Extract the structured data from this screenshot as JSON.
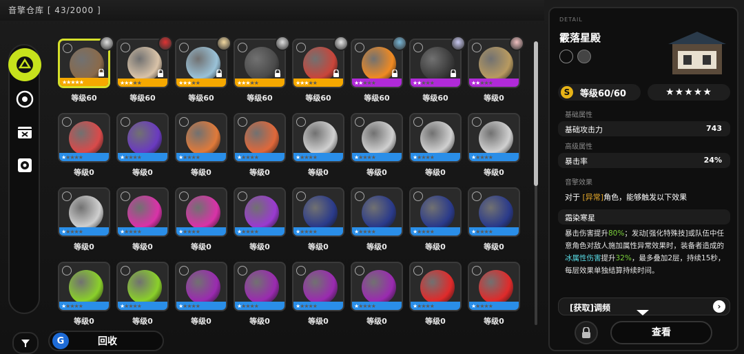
{
  "header": {
    "title": "音擎仓库 [ 43/2000 ]"
  },
  "sidebar": {
    "icons": [
      "category-all-icon",
      "disc-icon",
      "box-icon",
      "safe-icon"
    ],
    "filter_icon": "filter-icon"
  },
  "footer": {
    "recycle_label": "回收"
  },
  "grid": {
    "items": [
      {
        "level": "等级60",
        "stars": 5,
        "rarity": "gold",
        "art": "#8a6a4a",
        "avatar": "#e0e0e0",
        "locked": true,
        "selected": true
      },
      {
        "level": "等级60",
        "stars": 3,
        "rarity": "gold",
        "art": "#d9c3a8",
        "avatar": "#d33",
        "locked": true
      },
      {
        "level": "等级60",
        "stars": 3,
        "rarity": "gold",
        "art": "#9ac2d8",
        "avatar": "#f2d8a0",
        "locked": true
      },
      {
        "level": "等级60",
        "stars": 3,
        "rarity": "gold",
        "art": "#4a4a4a",
        "avatar": "#ddd",
        "locked": true
      },
      {
        "level": "等级60",
        "stars": 3,
        "rarity": "gold",
        "art": "#c9453a",
        "avatar": "#e6e6e6",
        "locked": true
      },
      {
        "level": "等级60",
        "stars": 2,
        "rarity": "purple",
        "art": "#f08a22",
        "avatar": "#7ab8d8",
        "locked": true
      },
      {
        "level": "等级60",
        "stars": 2,
        "rarity": "purple",
        "art": "#3a3a3a",
        "avatar": "#c8c8f0",
        "locked": true
      },
      {
        "level": "等级0",
        "stars": 2,
        "rarity": "purple",
        "art": "#b89a60",
        "avatar": "#f0c0c0",
        "locked": false
      },
      {
        "level": "等级0",
        "stars": 1,
        "rarity": "blue",
        "art": "#d94a4a",
        "locked": false
      },
      {
        "level": "等级0",
        "stars": 1,
        "rarity": "blue",
        "art": "#6a3ac0",
        "locked": false
      },
      {
        "level": "等级0",
        "stars": 1,
        "rarity": "blue",
        "art": "#e07a3a",
        "locked": false
      },
      {
        "level": "等级0",
        "stars": 1,
        "rarity": "blue",
        "art": "#e0683a",
        "locked": false
      },
      {
        "level": "等级0",
        "stars": 1,
        "rarity": "blue",
        "art": "#d0d0d0",
        "locked": false
      },
      {
        "level": "等级0",
        "stars": 1,
        "rarity": "blue",
        "art": "#d0d0d0",
        "locked": false
      },
      {
        "level": "等级0",
        "stars": 1,
        "rarity": "blue",
        "art": "#d0d0d0",
        "locked": false
      },
      {
        "level": "等级0",
        "stars": 1,
        "rarity": "blue",
        "art": "#d0d0d0",
        "locked": false
      },
      {
        "level": "等级0",
        "stars": 1,
        "rarity": "blue",
        "art": "#cfcfcf",
        "locked": false
      },
      {
        "level": "等级0",
        "stars": 1,
        "rarity": "blue",
        "art": "#d932a8",
        "locked": false
      },
      {
        "level": "等级0",
        "stars": 1,
        "rarity": "blue",
        "art": "#d932a8",
        "locked": false
      },
      {
        "level": "等级0",
        "stars": 1,
        "rarity": "blue",
        "art": "#9a3ad0",
        "locked": false
      },
      {
        "level": "等级0",
        "stars": 1,
        "rarity": "blue",
        "art": "#2a3a8a",
        "locked": false
      },
      {
        "level": "等级0",
        "stars": 1,
        "rarity": "blue",
        "art": "#2a3a8a",
        "locked": false
      },
      {
        "level": "等级0",
        "stars": 1,
        "rarity": "blue",
        "art": "#2a3a8a",
        "locked": false
      },
      {
        "level": "等级0",
        "stars": 1,
        "rarity": "blue",
        "art": "#2a3a8a",
        "locked": false
      },
      {
        "level": "等级0",
        "stars": 1,
        "rarity": "blue",
        "art": "#8ad02a",
        "locked": false
      },
      {
        "level": "等级0",
        "stars": 1,
        "rarity": "blue",
        "art": "#8ad02a",
        "locked": false
      },
      {
        "level": "等级0",
        "stars": 1,
        "rarity": "blue",
        "art": "#9a2ab0",
        "locked": false
      },
      {
        "level": "等级0",
        "stars": 1,
        "rarity": "blue",
        "art": "#9a2ab0",
        "locked": false
      },
      {
        "level": "等级0",
        "stars": 1,
        "rarity": "blue",
        "art": "#9a2ab0",
        "locked": false
      },
      {
        "level": "等级0",
        "stars": 1,
        "rarity": "blue",
        "art": "#9a2ab0",
        "locked": false
      },
      {
        "level": "等级0",
        "stars": 1,
        "rarity": "blue",
        "art": "#e02a2a",
        "locked": false
      },
      {
        "level": "等级0",
        "stars": 1,
        "rarity": "blue",
        "art": "#e02a2a",
        "locked": false
      }
    ]
  },
  "detail": {
    "label": "DETAIL",
    "name": "霰落星殿",
    "level": "等级60/60",
    "stars": "★★★★★",
    "base_section": "基础属性",
    "base_key": "基础攻击力",
    "base_val": "743",
    "adv_section": "高级属性",
    "adv_key": "暴击率",
    "adv_val": "24%",
    "effect_section": "音擎效果",
    "effect_pre": "对于 ",
    "effect_tag": "[异常]",
    "effect_post": "角色，能够触发以下效果",
    "set_name": "霜染寒星",
    "desc_1": "暴击伤害提升",
    "desc_g1": "80%",
    "desc_2": "；发动[强化特殊技]或队伍中任意角色对敌人施加属性异常效果时，装备者造成的",
    "desc_c": "冰属性伤害",
    "desc_3": "提升",
    "desc_g2": "32%",
    "desc_4": "，最多叠加2层，持续15秒，每层效果单独结算持续时间。",
    "acquire_label": "[获取]调频",
    "view_label": "查看"
  },
  "colors": {
    "gold": "#f5a800",
    "purple": "#b02ad8",
    "blue": "#2a8ee8",
    "accent": "#c7e21c"
  }
}
